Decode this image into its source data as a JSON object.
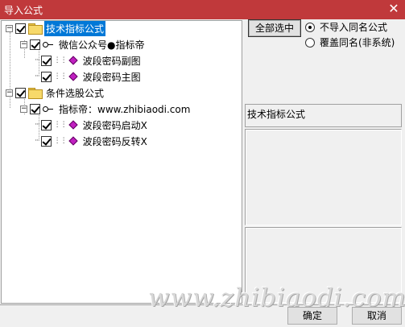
{
  "window": {
    "title": "导入公式",
    "close": "✕"
  },
  "tree": {
    "nodes": [
      {
        "id": "n0",
        "label": "技术指标公式",
        "type": "folder",
        "checked": true,
        "selected": true
      },
      {
        "id": "n1",
        "label": "微信公众号●指标帝",
        "type": "key",
        "checked": true
      },
      {
        "id": "n2",
        "label": "波段密码副图",
        "type": "formula",
        "checked": true
      },
      {
        "id": "n3",
        "label": "波段密码主图",
        "type": "formula",
        "checked": true
      },
      {
        "id": "n4",
        "label": "条件选股公式",
        "type": "folder",
        "checked": true
      },
      {
        "id": "n5",
        "label": "指标帝：www.zhibiaodi.com",
        "type": "key",
        "checked": true
      },
      {
        "id": "n6",
        "label": "波段密码启动X",
        "type": "formula",
        "checked": true
      },
      {
        "id": "n7",
        "label": "波段密码反转X",
        "type": "formula",
        "checked": true
      }
    ]
  },
  "right": {
    "select_all": "全部选中",
    "radio_no_import": "不导入同名公式",
    "radio_overwrite": "覆盖同名(非系统)",
    "radio_selected": "no_import",
    "info_label": "技术指标公式"
  },
  "footer": {
    "ok": "确定",
    "cancel": "取消",
    "watermark": "www.zhibiaodi.com"
  },
  "colors": {
    "titlebar": "#c0393b",
    "selection": "#0078d7",
    "gem": "#c020c0",
    "folder": "#f7d96a"
  }
}
